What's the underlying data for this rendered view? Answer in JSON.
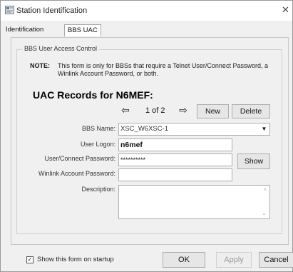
{
  "window": {
    "title": "Station Identification",
    "icon": "app-icon"
  },
  "tabs": [
    {
      "label": "Identification",
      "active": false
    },
    {
      "label": "BBS UAC",
      "active": true
    }
  ],
  "group": {
    "legend": "BBS User Access Control"
  },
  "note": {
    "label": "NOTE:",
    "text": "This form is only for BBSs that require a Telnet User/Connect Password, a Winlink Account Password, or both."
  },
  "uac": {
    "heading": "UAC Records for N6MEF:",
    "prev_icon": "left-arrow-icon",
    "next_icon": "right-arrow-icon",
    "counter": "1 of 2",
    "new_label": "New",
    "delete_label": "Delete"
  },
  "form": {
    "bbs_name_label": "BBS Name:",
    "bbs_name_value": "XSC_W6XSC-1",
    "user_logon_label": "User Logon:",
    "user_logon_value": "n6mef",
    "password_label": "User/Connect Password:",
    "password_value": "**********",
    "show_label": "Show",
    "winlink_label": "Winlink Account Password:",
    "winlink_value": "",
    "description_label": "Description:",
    "description_value": ""
  },
  "footer": {
    "show_on_startup_label": "Show this form on startup",
    "show_on_startup_checked": true,
    "ok_label": "OK",
    "apply_label": "Apply",
    "apply_enabled": false,
    "cancel_label": "Cancel"
  }
}
